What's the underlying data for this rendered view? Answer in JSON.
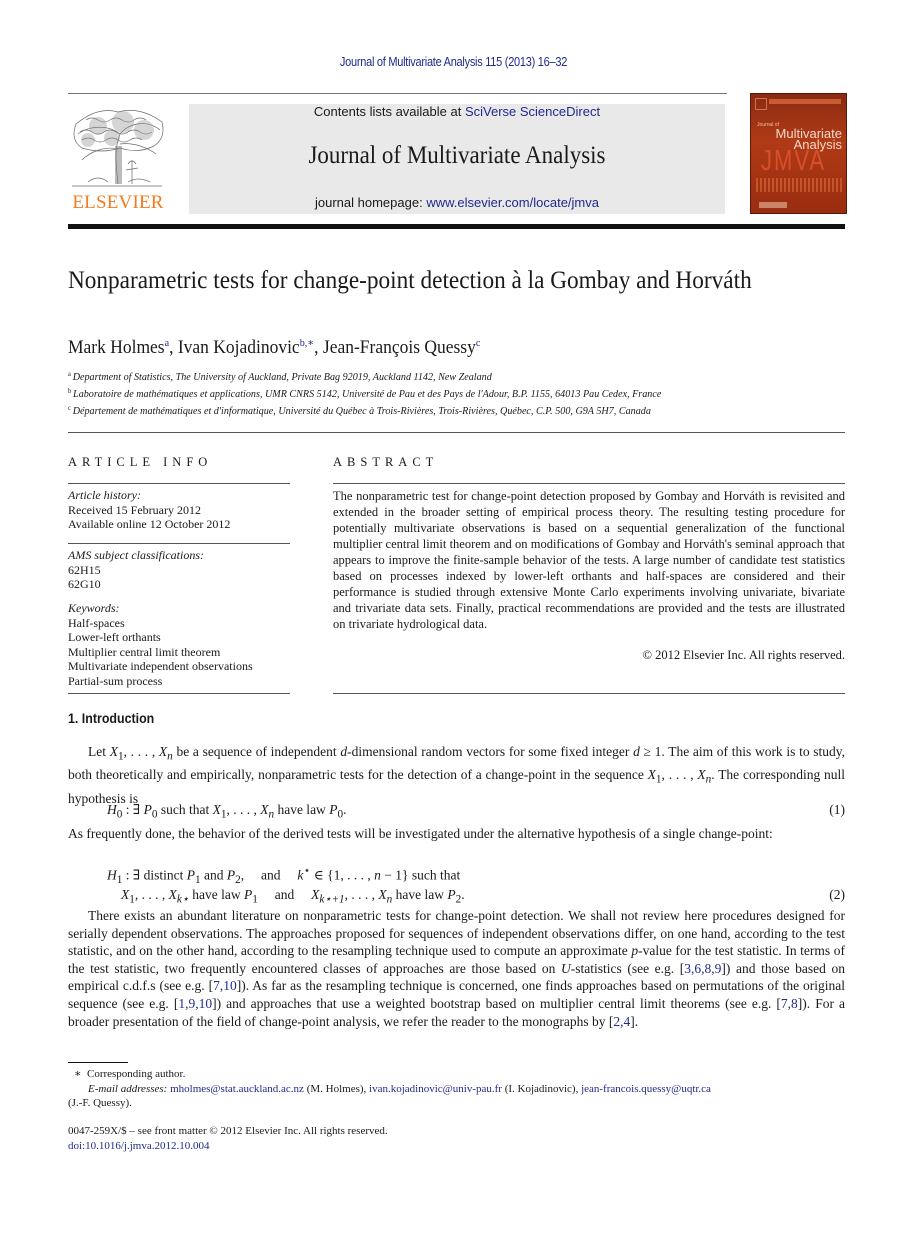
{
  "header": {
    "citation": "Journal of Multivariate Analysis 115 (2013) 16–32",
    "contents_prefix": "Contents lists available at ",
    "contents_link": "SciVerse ScienceDirect",
    "journal_title": "Journal of Multivariate Analysis",
    "homepage_prefix": "journal homepage: ",
    "homepage_link": "www.elsevier.com/locate/jmva",
    "publisher_logo": "ELSEVIER",
    "cover": {
      "journal_of": "Journal of",
      "name_line1": "Multivariate",
      "name_line2": "Analysis",
      "acronym": "JMVA"
    },
    "colors": {
      "link": "#1f2a8c",
      "elsevier_orange": "#f07c1f",
      "banner_bg": "#e9e9e9",
      "cover": "#b03a16"
    }
  },
  "article": {
    "title": "Nonparametric tests for change-point detection à la Gombay and Horváth",
    "authors": [
      {
        "name": "Mark Holmes",
        "sup": "a",
        "sep": ", "
      },
      {
        "name": "Ivan Kojadinovic",
        "sup": "b,∗",
        "sep": ", "
      },
      {
        "name": "Jean-François Quessy",
        "sup": "c",
        "sep": ""
      }
    ],
    "affiliations": [
      {
        "sup": "a",
        "text": "Department of Statistics, The University of Auckland, Private Bag 92019, Auckland 1142, New Zealand"
      },
      {
        "sup": "b",
        "text": "Laboratoire de mathématiques et applications, UMR CNRS 5142, Université de Pau et des Pays de l'Adour, B.P. 1155, 64013 Pau Cedex, France"
      },
      {
        "sup": "c",
        "text": "Département de mathématiques et d'informatique, Université du Québec à Trois-Rivières, Trois-Rivières, Québec, C.P. 500, G9A 5H7, Canada"
      }
    ]
  },
  "article_info": {
    "heading": "ARTICLE INFO",
    "history_label": "Article history:",
    "received": "Received 15 February 2012",
    "available": "Available online 12 October 2012",
    "ams_label": "AMS subject classifications:",
    "ams_codes": [
      "62H15",
      "62G10"
    ],
    "keywords_label": "Keywords:",
    "keywords": [
      "Half-spaces",
      "Lower-left orthants",
      "Multiplier central limit theorem",
      "Multivariate independent observations",
      "Partial-sum process"
    ]
  },
  "abstract": {
    "heading": "ABSTRACT",
    "text": "The nonparametric test for change-point detection proposed by Gombay and Horváth is revisited and extended in the broader setting of empirical process theory. The resulting testing procedure for potentially multivariate observations is based on a sequential generalization of the functional multiplier central limit theorem and on modifications of Gombay and Horváth's seminal approach that appears to improve the finite-sample behavior of the tests. A large number of candidate test statistics based on processes indexed by lower-left orthants and half-spaces are considered and their performance is studied through extensive Monte Carlo experiments involving univariate, bivariate and trivariate data sets. Finally, practical recommendations are provided and the tests are illustrated on trivariate hydrological data.",
    "copyright": "© 2012 Elsevier Inc. All rights reserved."
  },
  "introduction": {
    "heading": "1.  Introduction",
    "p1": {
      "t1": "Let ",
      "t2": " be a sequence of independent ",
      "d": "d",
      "t3": "-dimensional random vectors for some fixed integer ",
      "t4": " ≥ 1. The aim of this work is to study, both theoretically and empirically, nonparametric tests for the detection of a change-point in the sequence ",
      "t5": ". The corresponding null hypothesis is"
    },
    "eq1": {
      "lhs": "H",
      "lhs_sub": "0",
      "body1": " : ∃ ",
      "P0": "P",
      "P0_sub": "0",
      "body2": " such that ",
      "body3": " have law ",
      "end": ".",
      "number": "(1)"
    },
    "p2": "As frequently done, the behavior of the derived tests will be investigated under the alternative hypothesis of a single change-point:",
    "eq2": {
      "line1_a": " : ∃ distinct ",
      "line1_b": " and ",
      "line1_c": ",     and     ",
      "line1_d": " ∈ {1, . . . , ",
      "line1_e": " − 1} such that",
      "line2_a": " have law ",
      "line2_b": "     and     ",
      "line2_c": " have law ",
      "number": "(2)"
    },
    "p3": {
      "s1": "There exists an abundant literature on nonparametric tests for change-point detection. We shall not review here procedures designed for serially dependent observations. The approaches proposed for sequences of independent observations differ, on one hand, according to the test statistic, and on the other hand, according to the resampling technique used to compute an approximate ",
      "p": "p",
      "s2": "-value for the test statistic. In terms of the test statistic, two frequently encountered classes of approaches are those based on ",
      "U": "U",
      "s3": "-statistics (see e.g. [",
      "c1": "3,6,8,9",
      "s4": "]) and those based on empirical c.d.f.s (see e.g. [",
      "c2": "7,10",
      "s5": "]). As far as the resampling technique is concerned, one finds approaches based on permutations of the original sequence (see e.g. [",
      "c3": "1,9,10",
      "s6": "]) and approaches that use a weighted bootstrap based on multiplier central limit theorems (see e.g. [",
      "c4": "7,8",
      "s7": "]). For a broader presentation of the field of change-point analysis, we refer the reader to the monographs by [",
      "c5": "2,4",
      "s8": "]."
    }
  },
  "footnotes": {
    "star": "∗",
    "corresponding": "Corresponding author.",
    "email_label": "E-mail addresses:",
    "emails": [
      {
        "addr": "mholmes@stat.auckland.ac.nz",
        "who": " (M. Holmes), "
      },
      {
        "addr": "ivan.kojadinovic@univ-pau.fr",
        "who": " (I. Kojadinovic), "
      },
      {
        "addr": "jean-francois.quessy@uqtr.ca",
        "who": ""
      }
    ],
    "last_who": "(J.-F. Quessy).",
    "front_matter": "0047-259X/$ – see front matter © 2012 Elsevier Inc. All rights reserved.",
    "doi": "doi:10.1016/j.jmva.2012.10.004"
  }
}
